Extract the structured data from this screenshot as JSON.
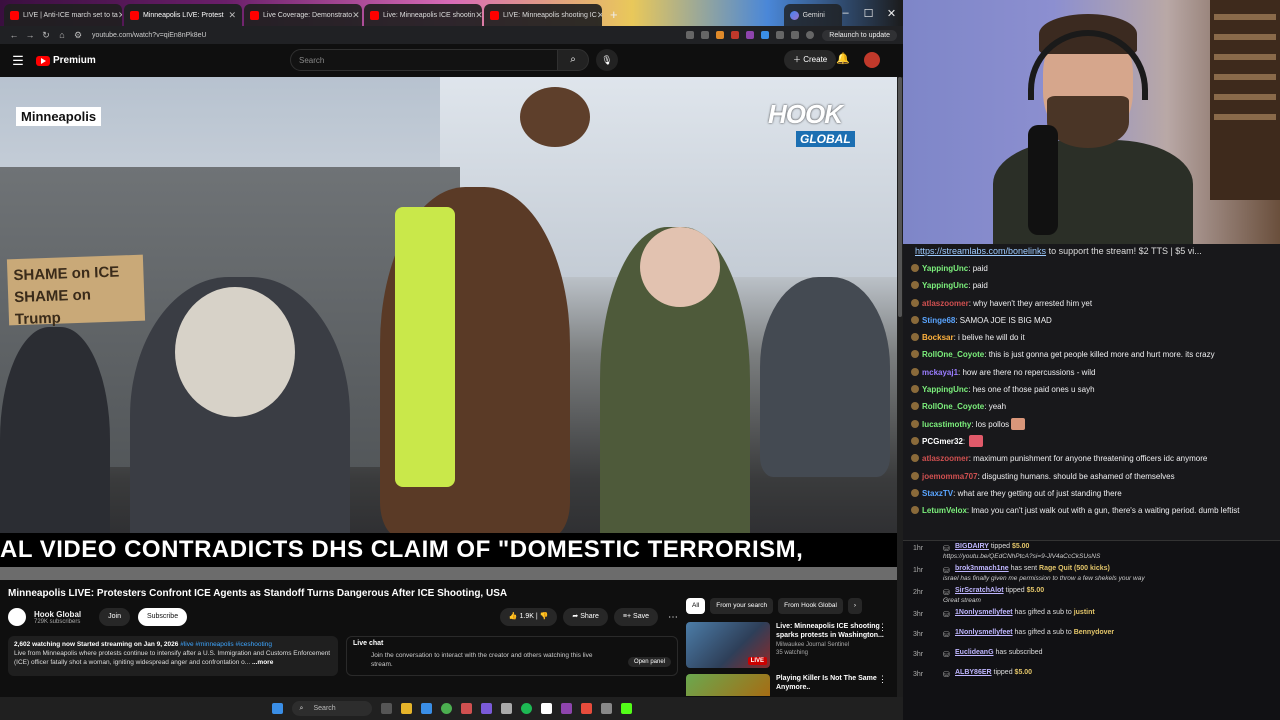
{
  "browser": {
    "tabs": [
      {
        "label": "LIVE | Anti-ICE march set to ta"
      },
      {
        "label": "Minneapolis LIVE: Protest"
      },
      {
        "label": "Live Coverage: Demonstrato"
      },
      {
        "label": "Live: Minneapolis ICE shootin"
      },
      {
        "label": "LIVE: Minneapolis shooting IC"
      },
      {
        "label": "Gemini"
      }
    ],
    "url": "youtube.com/watch?v=qiEn8nPk8eU",
    "relaunch": "Relaunch to update"
  },
  "youtube": {
    "logo": "Premium",
    "search_placeholder": "Search",
    "create": "Create"
  },
  "video": {
    "location_label": "Minneapolis",
    "sign_text": "SHAME on ICE SHAME on Trump",
    "brand_top": "HOOK",
    "brand_bottom": "GLOBAL",
    "ticker": "AL VIDEO CONTRADICTS DHS CLAIM OF \"DOMESTIC TERRORISM,"
  },
  "watch": {
    "title": "Minneapolis LIVE: Protesters Confront ICE Agents as Standoff Turns Dangerous After ICE Shooting, USA",
    "channel_name": "Hook Global",
    "channel_subs": "729K subscribers",
    "join": "Join",
    "subscribe": "Subscribe",
    "likes": "1.9K",
    "share": "Share",
    "save": "Save",
    "desc_stats": "2,602 watching now  Started streaming on Jan 9, 2026",
    "desc_tags": "#live #minneapolis #iceshooting",
    "desc_text": "Live from Minneapolis where protests continue to intensify after a U.S. Immigration and Customs Enforcement (ICE) officer fatally shot a woman, igniting widespread anger and confrontation o...",
    "desc_more": "...more",
    "livechat_title": "Live chat",
    "livechat_body": "Join the conversation to interact with the creator and others watching this live stream.",
    "livechat_button": "Open panel"
  },
  "recommendations": {
    "chips": [
      "All",
      "From your search",
      "From Hook Global"
    ],
    "items": [
      {
        "title": "Live: Minneapolis ICE shooting sparks protests in Washington...",
        "channel": "Milwaukee Journal Sentinel",
        "meta": "35 watching",
        "badge": "LIVE"
      },
      {
        "title": "Playing Killer Is Not The Same Anymore..",
        "channel": "",
        "meta": "",
        "badge": ""
      }
    ]
  },
  "taskbar": {
    "search": "Search"
  },
  "chat": {
    "banner_link": "https://streamlabs.com/bonelinks",
    "banner_text": " to support the stream! $2 TTS | $5 vi...",
    "messages": [
      {
        "user": "YappingUnc",
        "color": "#7cf07c",
        "text": "paid"
      },
      {
        "user": "YappingUnc",
        "color": "#7cf07c",
        "text": "paid"
      },
      {
        "user": "atlaszoomer",
        "color": "#d05050",
        "text": "why haven't they arrested him yet"
      },
      {
        "user": "Stinge68",
        "color": "#5aa5ff",
        "text": "SAMOA JOE IS BIG MAD"
      },
      {
        "user": "Bocksar",
        "color": "#ffb23e",
        "text": "i belive he will do it"
      },
      {
        "user": "RollOne_Coyote",
        "color": "#7cf07c",
        "text": "this is just gonna get people killed more and hurt more. its crazy"
      },
      {
        "user": "mckayaj1",
        "color": "#9a7cff",
        "text": "how are there no repercussions - wild"
      },
      {
        "user": "YappingUnc",
        "color": "#7cf07c",
        "text": "hes one of those paid ones u sayh"
      },
      {
        "user": "RollOne_Coyote",
        "color": "#7cf07c",
        "text": "yeah"
      },
      {
        "user": "lucastimothy",
        "color": "#7cf07c",
        "text": "los pollos"
      },
      {
        "user": "PCGmer32",
        "color": "#ffffff",
        "text": ""
      },
      {
        "user": "atlaszoomer",
        "color": "#d05050",
        "text": "maximum punishment for anyone threatening officers idc anymore"
      },
      {
        "user": "joemomma707",
        "color": "#d05050",
        "text": "disgusting humans. should be ashamed of themselves"
      },
      {
        "user": "StaxzTV",
        "color": "#5aa5ff",
        "text": "what are they getting out of just standing there"
      },
      {
        "user": "LetumVelox",
        "color": "#7cf07c",
        "text": "lmao you can't just walk out with a gun, there's a waiting period. dumb leftist"
      }
    ],
    "events": [
      {
        "time": "1hr",
        "user": "BIGDAIRY",
        "action": " tipped ",
        "amount": "$5.00",
        "detail": "https://youtu.be/QEdCNhPtcA?si=9-JlV4aCcCkSUsNS"
      },
      {
        "time": "1hr",
        "user": "brok3nmach1ne",
        "action": " has sent ",
        "amount": "Rage Quit (500 kicks)",
        "detail": "israel has finally given me permission to throw a few shekels your way"
      },
      {
        "time": "2hr",
        "user": "SirScratchAlot",
        "action": " tipped ",
        "amount": "$5.00",
        "detail": "Great stream"
      },
      {
        "time": "3hr",
        "user": "1Nonlysmellyfeet",
        "action": " has gifted a sub to ",
        "amount": "justint",
        "detail": ""
      },
      {
        "time": "3hr",
        "user": "1Nonlysmellyfeet",
        "action": " has gifted a sub to ",
        "amount": "Bennydover",
        "detail": ""
      },
      {
        "time": "3hr",
        "user": "EuclideanG",
        "action": " has subscribed",
        "amount": "",
        "detail": ""
      },
      {
        "time": "3hr",
        "user": "ALBY86ER",
        "action": " tipped ",
        "amount": "$5.00",
        "detail": ""
      }
    ]
  },
  "colors": {
    "yt_red": "#ff0000",
    "bg": "#0f0f0f",
    "chat_bg": "#18181b"
  }
}
